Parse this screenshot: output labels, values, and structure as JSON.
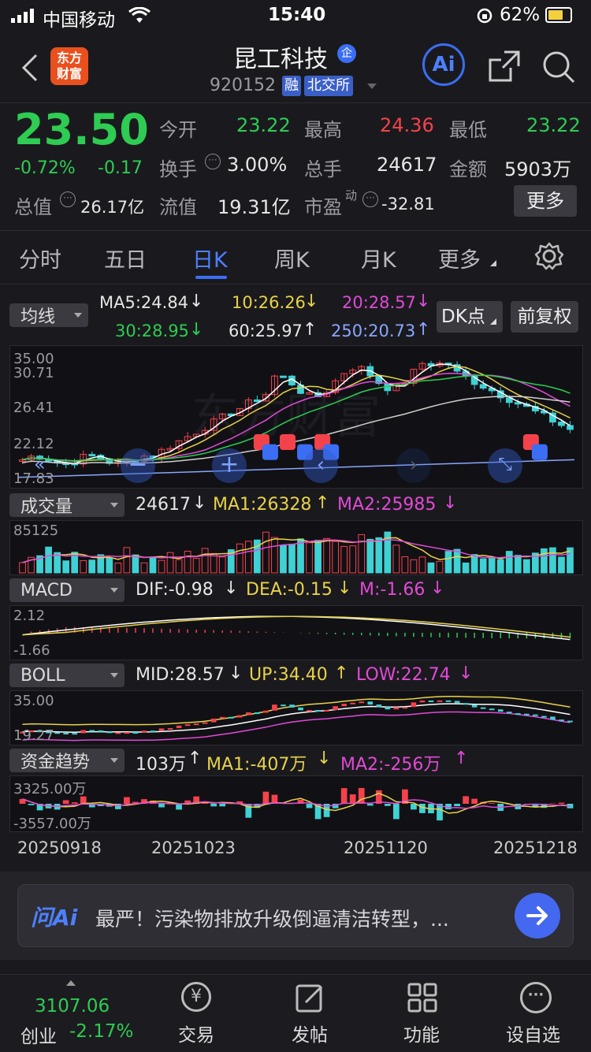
{
  "status_bar": {
    "carrier": "中国移动",
    "time": "15:40",
    "battery": "62%"
  },
  "header": {
    "logo_line1": "东方",
    "logo_line2": "财富",
    "stock_name": "昆工科技",
    "name_badge": "企",
    "code": "920152",
    "tag_margin": "融",
    "tag_exchange": "北交所",
    "ai_label": "Ai"
  },
  "quote": {
    "price": "23.50",
    "change_pct": "-0.72%",
    "change": "-0.17",
    "open_label": "今开",
    "open": "23.22",
    "high_label": "最高",
    "high": "24.36",
    "low_label": "最低",
    "low": "23.22",
    "turnover_label": "换手",
    "turnover": "3.00%",
    "volume_label": "总手",
    "volume": "24617",
    "amount_label": "金额",
    "amount": "5903万",
    "mktcap_label": "总值",
    "mktcap": "26.17亿",
    "float_label": "流值",
    "float": "19.31亿",
    "pe_label": "市盈",
    "pe_sup": "动",
    "pe": "-32.81",
    "more_button": "更多"
  },
  "tabs": [
    "分时",
    "五日",
    "日K",
    "周K",
    "月K",
    "更多"
  ],
  "active_tab": "日K",
  "ma_bar": {
    "selector": "均线",
    "ma5": "MA5:24.84",
    "ma10": "10:26.26",
    "ma20": "20:28.57",
    "ma30": "30:28.95",
    "ma60": "60:25.97",
    "ma250": "250:20.73",
    "dk_button": "DK点",
    "fq_button": "前复权"
  },
  "kline": {
    "y_labels": [
      "35.00",
      "30.71",
      "26.41",
      "22.12",
      "17.83"
    ],
    "watermark": "东方财富"
  },
  "volume_bar": {
    "selector": "成交量",
    "value": "24617",
    "ma1": "MA1:26328",
    "ma2": "MA2:25985",
    "y_label": "85125"
  },
  "macd_bar": {
    "selector": "MACD",
    "dif": "DIF:-0.98",
    "dea": "DEA:-0.15",
    "m": "M:-1.66",
    "y_top": "2.12",
    "y_bottom": "-1.66"
  },
  "boll_bar": {
    "selector": "BOLL",
    "mid": "MID:28.57",
    "up": "UP:34.40",
    "low": "LOW:22.74",
    "y_top": "35.00",
    "y_bottom": "19.27"
  },
  "fund_bar": {
    "selector": "资金趋势",
    "value": "103万",
    "ma1": "MA1:-407万",
    "ma2": "MA2:-256万",
    "y_top": "3325.00万",
    "y_bottom": "-3557.00万"
  },
  "dates": [
    "20250918",
    "20251023",
    "20251120",
    "20251218"
  ],
  "ai_bar": {
    "logo": "问Ai",
    "text": "最严！污染物排放升级倒逼清洁转型，..."
  },
  "bottom_nav": {
    "index_value": "3107.06",
    "index_name": "创业",
    "index_change": "-2.17%",
    "trade": "交易",
    "trade_icon_text": "¥",
    "post": "发帖",
    "features": "功能",
    "settings": "设自选"
  },
  "colors": {
    "up": "#f4424b",
    "down": "#2ecc52",
    "accent": "#3b6ef5",
    "background": "#1a1a1e"
  }
}
